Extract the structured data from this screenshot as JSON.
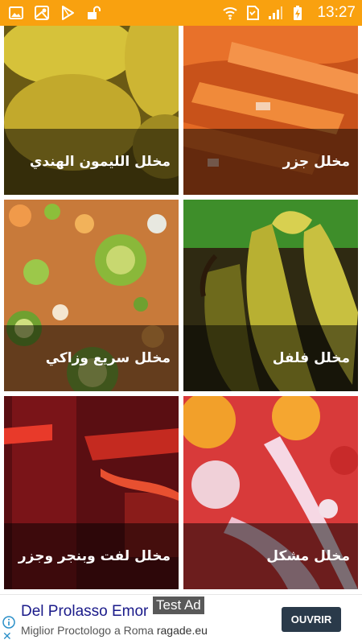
{
  "status_bar": {
    "time": "13:27",
    "left_icons": [
      "image-icon",
      "map-icon",
      "play-store-icon",
      "unlock-icon"
    ],
    "right_icons": [
      "wifi-icon",
      "sim-icon",
      "signal-icon",
      "battery-charging-icon"
    ],
    "color": "#f9a10f"
  },
  "recipes": [
    {
      "label": "مخلل جزر",
      "photo": "carrots"
    },
    {
      "label": "مخلل الليمون الهندي",
      "photo": "indian-lemon"
    },
    {
      "label": "مخلل فلفل",
      "photo": "peppers"
    },
    {
      "label": "مخلل سريع وزاكي",
      "photo": "quick-mixed"
    },
    {
      "label": "مخلل مشكل",
      "photo": "mixed-pickle"
    },
    {
      "label": "مخلل لفت وبنجر وجزر",
      "photo": "turnip-beet-carrot"
    }
  ],
  "ad": {
    "badge": "Test Ad",
    "title": "Del Prolasso Emor",
    "subtitle": "Miglior Proctologo a Roma",
    "domain": "ragade.eu",
    "cta": "OUVRIR",
    "close": "✕"
  }
}
